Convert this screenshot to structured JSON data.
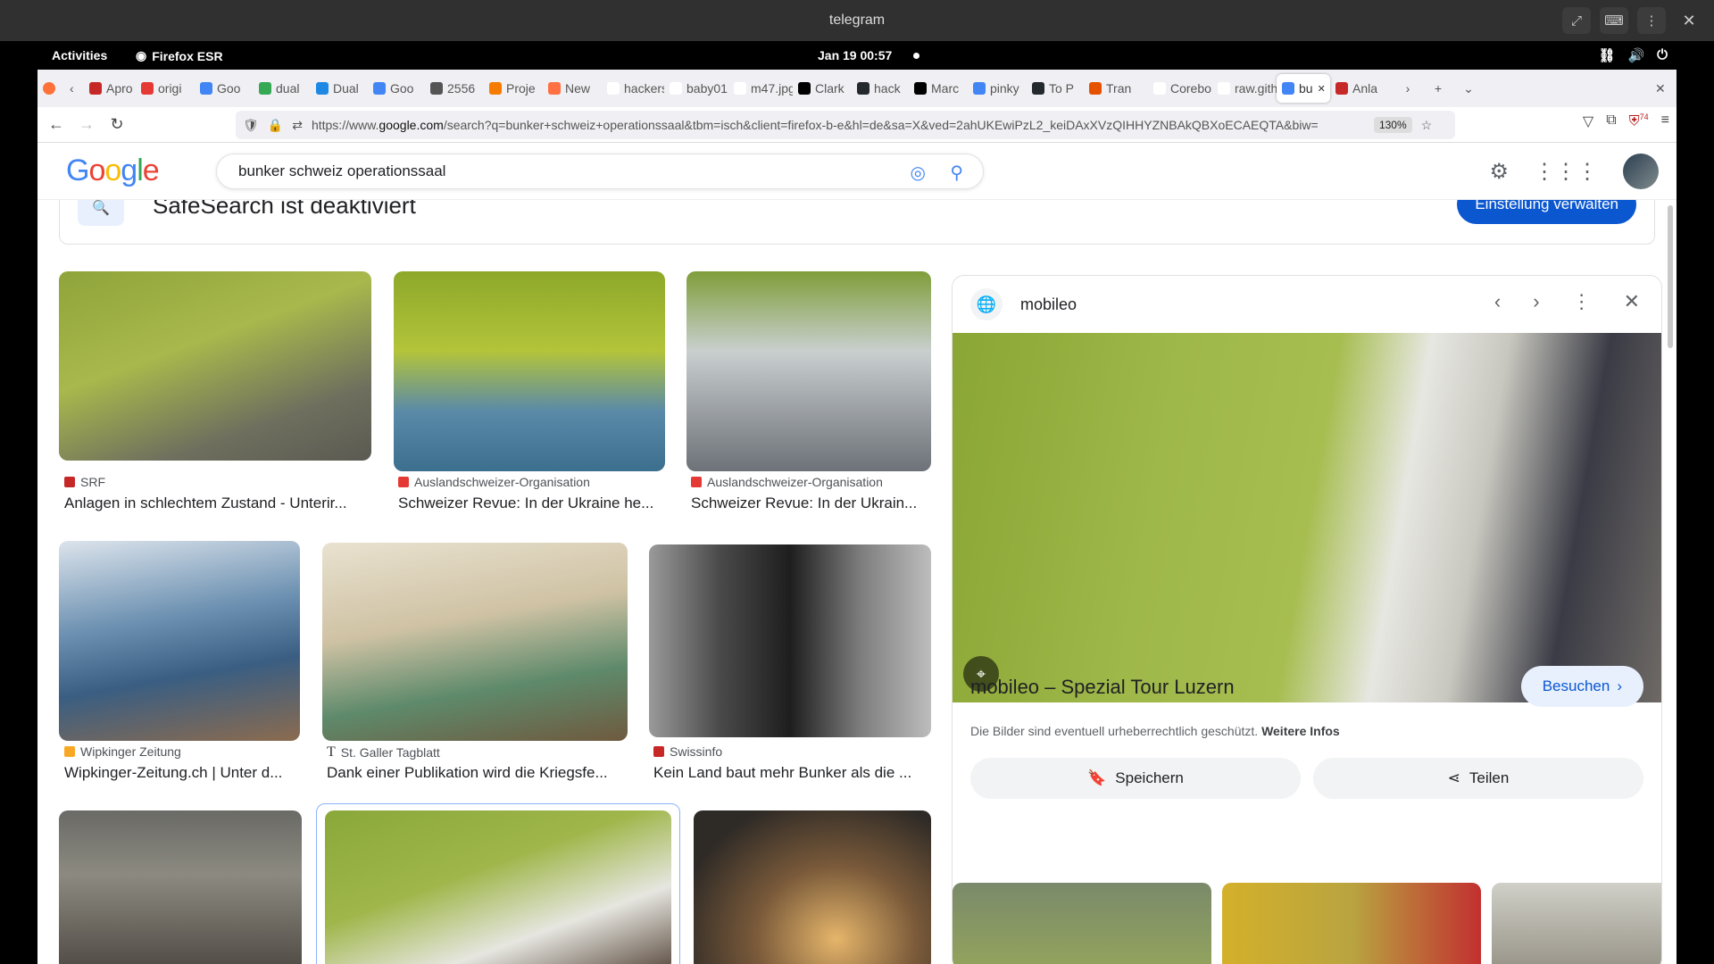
{
  "window": {
    "title": "telegram"
  },
  "system": {
    "activities": "Activities",
    "app": "Firefox ESR",
    "clock": "Jan 19  00:57"
  },
  "tabs": [
    {
      "label": "Apro",
      "color": "#c62828"
    },
    {
      "label": "origi",
      "color": "#e53935"
    },
    {
      "label": "Goo",
      "color": "#4285f4"
    },
    {
      "label": "dual",
      "color": "#34a853"
    },
    {
      "label": "Dual",
      "color": "#1e88e5"
    },
    {
      "label": "Goo",
      "color": "#4285f4"
    },
    {
      "label": "2556",
      "color": "#555555"
    },
    {
      "label": "Proje",
      "color": "#f57c00"
    },
    {
      "label": "New",
      "color": "#ff7043"
    },
    {
      "label": "hackers",
      "color": "#ffffff"
    },
    {
      "label": "baby01.",
      "color": "#ffffff"
    },
    {
      "label": "m47.jpg",
      "color": "#ffffff"
    },
    {
      "label": "Clark",
      "color": "#000000"
    },
    {
      "label": "hack",
      "color": "#24292e"
    },
    {
      "label": "Marc",
      "color": "#000000"
    },
    {
      "label": "pinky",
      "color": "#4285f4"
    },
    {
      "label": "To P",
      "color": "#24292e"
    },
    {
      "label": "Tran",
      "color": "#e65100"
    },
    {
      "label": "Corebo",
      "color": "#ffffff"
    },
    {
      "label": "raw.gith",
      "color": "#ffffff"
    },
    {
      "label": "bu",
      "color": "#4285f4",
      "active": true
    },
    {
      "label": "Anla",
      "color": "#c62828"
    }
  ],
  "navbar": {
    "url_prefix": "https://www.",
    "url_domain": "google.com",
    "url_rest": "/search?q=bunker+schweiz+operationssaal&tbm=isch&client=firefox-b-e&hl=de&sa=X&ved=2ahUKEwiPzL2_keiDAxXVzQIHHYZNBAkQBXoECAEQTA&biw=",
    "zoom": "130%",
    "ext_badge": "74"
  },
  "google": {
    "logo": "Google",
    "query": "bunker schweiz operationssaal",
    "safesearch": "SafeSearch ist deaktiviert",
    "safesearch_button": "Einstellung verwalten"
  },
  "results": [
    {
      "source": "SRF",
      "title": "Anlagen in schlechtem Zustand - Unterir...",
      "src_color": "#c62828"
    },
    {
      "source": "Auslandschweizer-Organisation",
      "title": "Schweizer Revue: In der Ukraine he...",
      "src_color": "#e53935"
    },
    {
      "source": "Auslandschweizer-Organisation",
      "title": "Schweizer Revue: In der Ukrain...",
      "src_color": "#e53935"
    },
    {
      "source": "Wipkinger Zeitung",
      "title": "Wipkinger-Zeitung.ch | Unter d...",
      "src_color": "#f9a825"
    },
    {
      "source": "St. Galler Tagblatt",
      "title": "Dank einer Publikation wird die Kriegsfe...",
      "src_color": "#333333"
    },
    {
      "source": "Swissinfo",
      "title": "Kein Land baut mehr Bunker als die ...",
      "src_color": "#c62828"
    }
  ],
  "panel": {
    "site": "mobileo",
    "title": "mobileo – Spezial Tour Luzern",
    "visit": "Besuchen",
    "copyright": "Die Bilder sind eventuell urheberrechtlich geschützt.",
    "more_info": "Weitere Infos",
    "save": "Speichern",
    "share": "Teilen"
  }
}
